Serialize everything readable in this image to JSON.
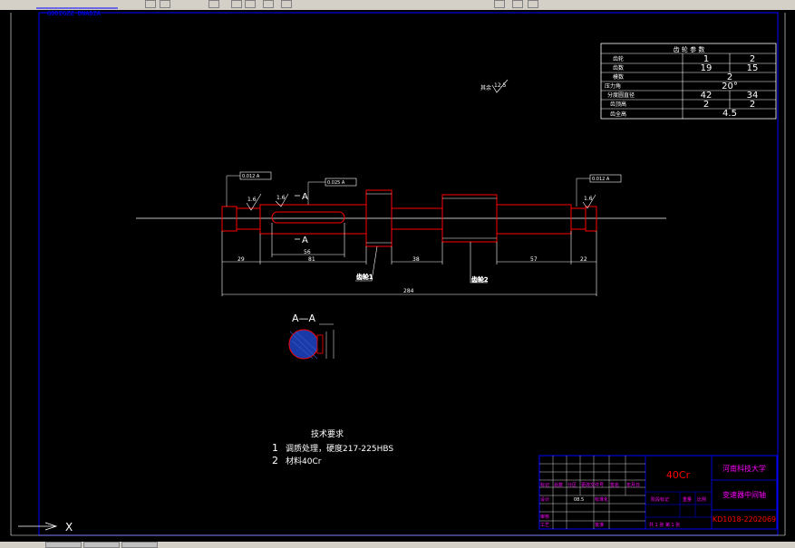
{
  "titlebar_fragment": "GOOZGZZ DNADZA",
  "params_table": {
    "header": "齿 轮 参 数",
    "rows": [
      {
        "label": "齿轮",
        "a": "1",
        "b": "2"
      },
      {
        "label": "齿数",
        "a": "19",
        "b": "15"
      },
      {
        "label": "模数",
        "a": "2",
        "b": ""
      },
      {
        "label": "压力角",
        "a": "20°",
        "b": ""
      },
      {
        "label": "分度圆直径",
        "a": "42",
        "b": "34"
      },
      {
        "label": "齿顶高",
        "a": "2",
        "b": "2"
      },
      {
        "label": "齿全高",
        "a": "4.5",
        "b": ""
      }
    ]
  },
  "roughness_note": {
    "label": "其余",
    "value": "12.5"
  },
  "section_labels": {
    "a_top": "A",
    "a_bottom": "A",
    "section_view": "A—A"
  },
  "surface_marks": [
    "1.6",
    "1.6",
    "1.6"
  ],
  "tolerance_frames": [
    "0.012 A",
    "0.025 A",
    "0.012 A"
  ],
  "dimensions": {
    "left_end": "29",
    "keyway_length": "81",
    "key_length": "56",
    "middle_gap": "38",
    "right_segment": "57",
    "right_end": "22",
    "total_length": "284"
  },
  "leader_labels": {
    "gear1": "齿轮1",
    "gear2": "齿轮2"
  },
  "tech_requirements": {
    "title": "技术要求",
    "items": [
      {
        "num": "1",
        "text": "调质处理，硬度217-225HBS"
      },
      {
        "num": "2",
        "text": "材料40Cr"
      }
    ]
  },
  "title_block": {
    "material": "40Cr",
    "school": "河南科技大学",
    "drawing_name": "变速器中间轴",
    "drawing_number": "KD1018-2202069",
    "sheet_info": "共 1 张 第 1 张",
    "labels": [
      "标记",
      "处数",
      "分区",
      "更改文件号",
      "签名",
      "年月日",
      "设计",
      "标准化",
      "阶段标记",
      "重量",
      "比例",
      "审核",
      "工艺",
      "批准"
    ],
    "date_code": "08.5"
  },
  "axis_mark": "X",
  "colors": {
    "background": "#000000",
    "border": "#0000ff",
    "outline": "#ff0000",
    "dimension": "#ffffff",
    "accent_text": "#ff00ff"
  }
}
